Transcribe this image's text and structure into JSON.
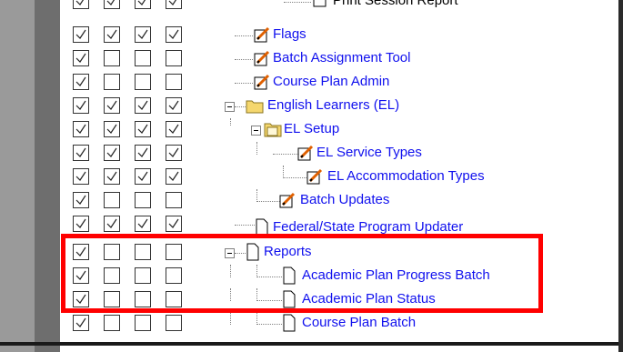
{
  "tree": {
    "rows": [
      {
        "label": "Print Session Report",
        "checks": [
          true,
          true,
          true,
          true
        ],
        "icon": "report-tool-icon",
        "partial": "top"
      },
      {
        "label": "Flags",
        "checks": [
          true,
          true,
          true,
          true
        ],
        "icon": "pencil-note-icon"
      },
      {
        "label": "Batch Assignment Tool",
        "checks": [
          true,
          false,
          false,
          false
        ],
        "icon": "pencil-note-icon"
      },
      {
        "label": "Course Plan Admin",
        "checks": [
          true,
          false,
          false,
          false
        ],
        "icon": "pencil-note-icon"
      },
      {
        "label": "English Learners (EL)",
        "checks": [
          true,
          true,
          true,
          true
        ],
        "icon": "folder-icon"
      },
      {
        "label": "EL Setup",
        "checks": [
          true,
          true,
          true,
          true
        ],
        "icon": "folder-open-icon"
      },
      {
        "label": "EL Service Types",
        "checks": [
          true,
          true,
          true,
          true
        ],
        "icon": "pencil-note-icon"
      },
      {
        "label": "EL Accommodation Types",
        "checks": [
          true,
          true,
          true,
          true
        ],
        "icon": "pencil-note-icon"
      },
      {
        "label": "Batch Updates",
        "checks": [
          true,
          false,
          false,
          false
        ],
        "icon": "pencil-note-icon"
      },
      {
        "label": "Federal/State Program Updater",
        "checks": [
          true,
          true,
          true,
          true
        ],
        "icon": "page-icon",
        "partial": "bottom"
      },
      {
        "label": "Reports",
        "checks": [
          true,
          false,
          false,
          false
        ],
        "icon": "page-icon"
      },
      {
        "label": "Academic Plan Progress Batch",
        "checks": [
          true,
          false,
          false,
          false
        ],
        "icon": "page-icon"
      },
      {
        "label": "Academic Plan Status",
        "checks": [
          true,
          false,
          false,
          false
        ],
        "icon": "page-icon"
      },
      {
        "label": "Course Plan Batch",
        "checks": [
          true,
          false,
          false,
          false
        ],
        "icon": "page-icon"
      }
    ]
  },
  "colors": {
    "link": "#1010ee",
    "highlight": "#ff0000"
  }
}
